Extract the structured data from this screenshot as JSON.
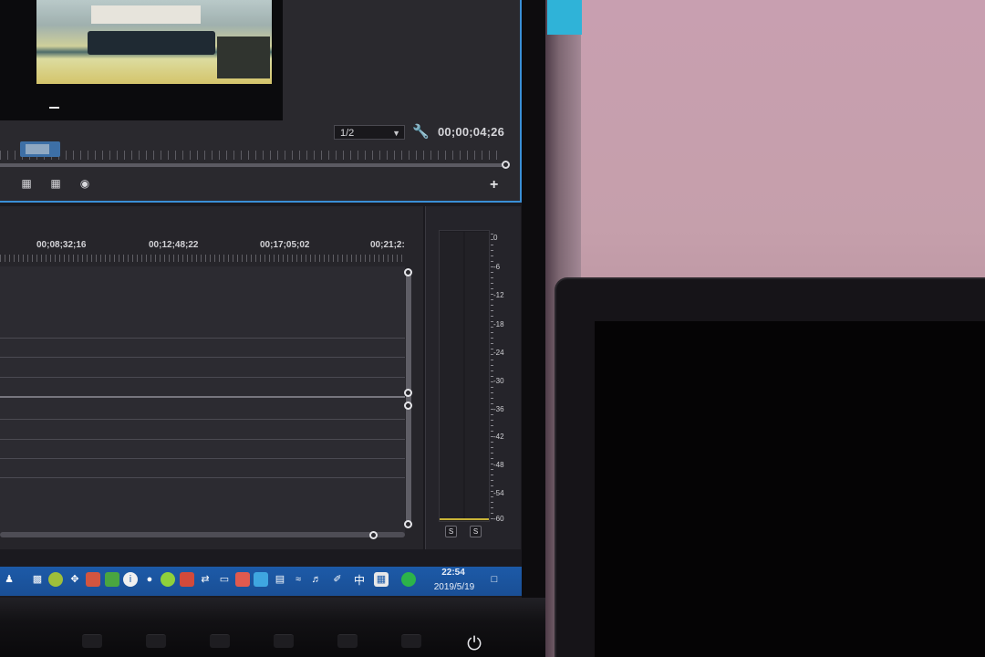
{
  "program_monitor": {
    "scale": "1/2",
    "timecode": "00;00;04;26"
  },
  "timeline": {
    "ruler_labels": [
      "00;08;32;16",
      "00;12;48;22",
      "00;17;05;02",
      "00;21;2:"
    ]
  },
  "audio_meter": {
    "db_labels": [
      "0",
      "-6",
      "-12",
      "-18",
      "-24",
      "-30",
      "-36",
      "-42",
      "-48",
      "-54",
      "-60"
    ],
    "solo_left": "S",
    "solo_right": "S"
  },
  "taskbar": {
    "ime_label": "中",
    "time": "22:54",
    "date": "2019/5/19",
    "icons": [
      "person-icon",
      "monitor-icon",
      "pet-icon",
      "move-icon",
      "app-red-icon",
      "app-green-icon",
      "info-icon",
      "wechat-icon",
      "app-lime-icon",
      "app-grid-icon",
      "sync-icon",
      "usb-icon",
      "app-red2-icon",
      "app-blue-icon",
      "folder-icon",
      "wifi-icon",
      "speaker-icon",
      "pen-icon",
      "keyboard-icon",
      "chat-icon",
      "notification-icon"
    ]
  },
  "colors": {
    "accent_blue": "#3a8fd6",
    "taskbar_blue": "#1c5aa8",
    "meter_floor": "#c9b437"
  }
}
